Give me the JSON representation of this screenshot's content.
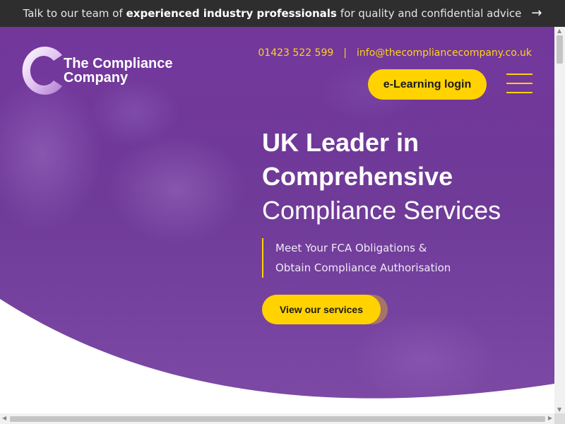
{
  "announcement": {
    "prefix": "Talk to our team of",
    "highlight": "experienced industry professionals",
    "suffix": "for quality and confidential advice",
    "arrow_icon": "arrow-right-icon"
  },
  "logo": {
    "line1": "The Compliance",
    "line2": "Company"
  },
  "contact": {
    "phone": "01423 522 599",
    "separator": "|",
    "email": "info@thecompliancecompany.co.uk"
  },
  "nav": {
    "login_label": "e-Learning login",
    "menu_icon": "hamburger-menu-icon"
  },
  "hero": {
    "title_line1": "UK Leader in",
    "title_line2": "Comprehensive",
    "title_line3": "Compliance Services",
    "sub_line1": "Meet Your FCA Obligations &",
    "sub_line2": "Obtain Compliance Authorisation",
    "cta_label": "View our services"
  },
  "colors": {
    "accent": "#ffd200",
    "hero_purple": "#73379c",
    "topbar": "#2e2e2e"
  }
}
